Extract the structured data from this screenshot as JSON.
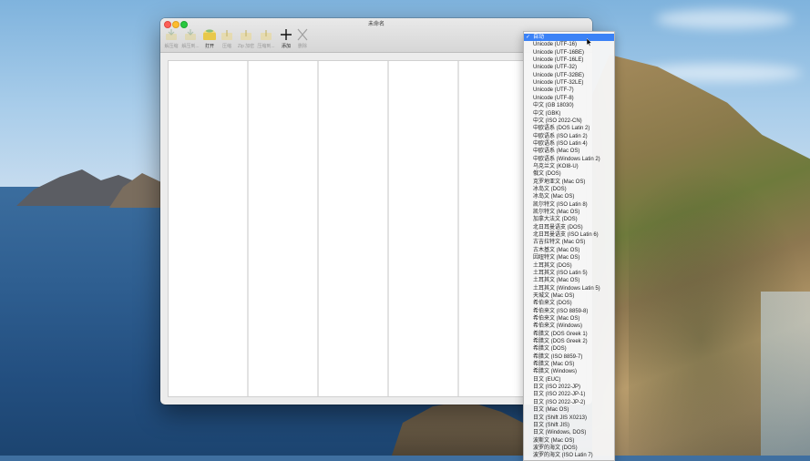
{
  "window": {
    "title": "未命名",
    "toolbar": [
      {
        "label": "解压缩",
        "icon": "extract-icon",
        "active": false
      },
      {
        "label": "解压到...",
        "icon": "extract-to-icon",
        "active": false
      },
      {
        "label": "打开",
        "icon": "open-archive-icon",
        "active": true
      },
      {
        "label": "压缩",
        "icon": "compress-icon",
        "active": false
      },
      {
        "label": "Zip 加密",
        "icon": "zip-encrypt-icon",
        "active": false
      },
      {
        "label": "压缩到...",
        "icon": "compress-to-icon",
        "active": false
      },
      {
        "label": "添加",
        "icon": "plus-icon",
        "active": true
      },
      {
        "label": "删除",
        "icon": "close-icon",
        "active": false
      }
    ]
  },
  "encoding_menu": {
    "selected_index": 0,
    "items": [
      "自动",
      "Unicode (UTF-16)",
      "Unicode (UTF-16BE)",
      "Unicode (UTF-16LE)",
      "Unicode (UTF-32)",
      "Unicode (UTF-32BE)",
      "Unicode (UTF-32LE)",
      "Unicode (UTF-7)",
      "Unicode (UTF-8)",
      "中文 (GB 18030)",
      "中文 (GBK)",
      "中文 (ISO 2022-CN)",
      "中欧语系 (DOS Latin 2)",
      "中欧语系 (ISO Latin 2)",
      "中欧语系 (ISO Latin 4)",
      "中欧语系 (Mac OS)",
      "中欧语系 (Windows Latin 2)",
      "乌克兰文 (KOI8-U)",
      "俄文 (DOS)",
      "克罗地亚文 (Mac OS)",
      "冰岛文 (DOS)",
      "冰岛文 (Mac OS)",
      "凯尔特文 (ISO Latin 8)",
      "凯尔特文 (Mac OS)",
      "加拿大法文 (DOS)",
      "北日耳曼语支 (DOS)",
      "北日耳曼语支 (ISO Latin 6)",
      "古吉拉特文 (Mac OS)",
      "古木基文 (Mac OS)",
      "因纽特文 (Mac OS)",
      "土耳其文 (DOS)",
      "土耳其文 (ISO Latin 5)",
      "土耳其文 (Mac OS)",
      "土耳其文 (Windows Latin 5)",
      "天城文 (Mac OS)",
      "希伯来文 (DOS)",
      "希伯来文 (ISO 8859-8)",
      "希伯来文 (Mac OS)",
      "希伯来文 (Windows)",
      "希腊文 (DOS Greek 1)",
      "希腊文 (DOS Greek 2)",
      "希腊文 (DOS)",
      "希腊文 (ISO 8859-7)",
      "希腊文 (Mac OS)",
      "希腊文 (Windows)",
      "日文 (EUC)",
      "日文 (ISO 2022-JP)",
      "日文 (ISO 2022-JP-1)",
      "日文 (ISO 2022-JP-2)",
      "日文 (Mac OS)",
      "日文 (Shift JIS X0213)",
      "日文 (Shift JIS)",
      "日文 (Windows, DOS)",
      "波斯文 (Mac OS)",
      "波罗的海文 (DOS)",
      "波罗的海文 (ISO Latin 7)"
    ]
  }
}
